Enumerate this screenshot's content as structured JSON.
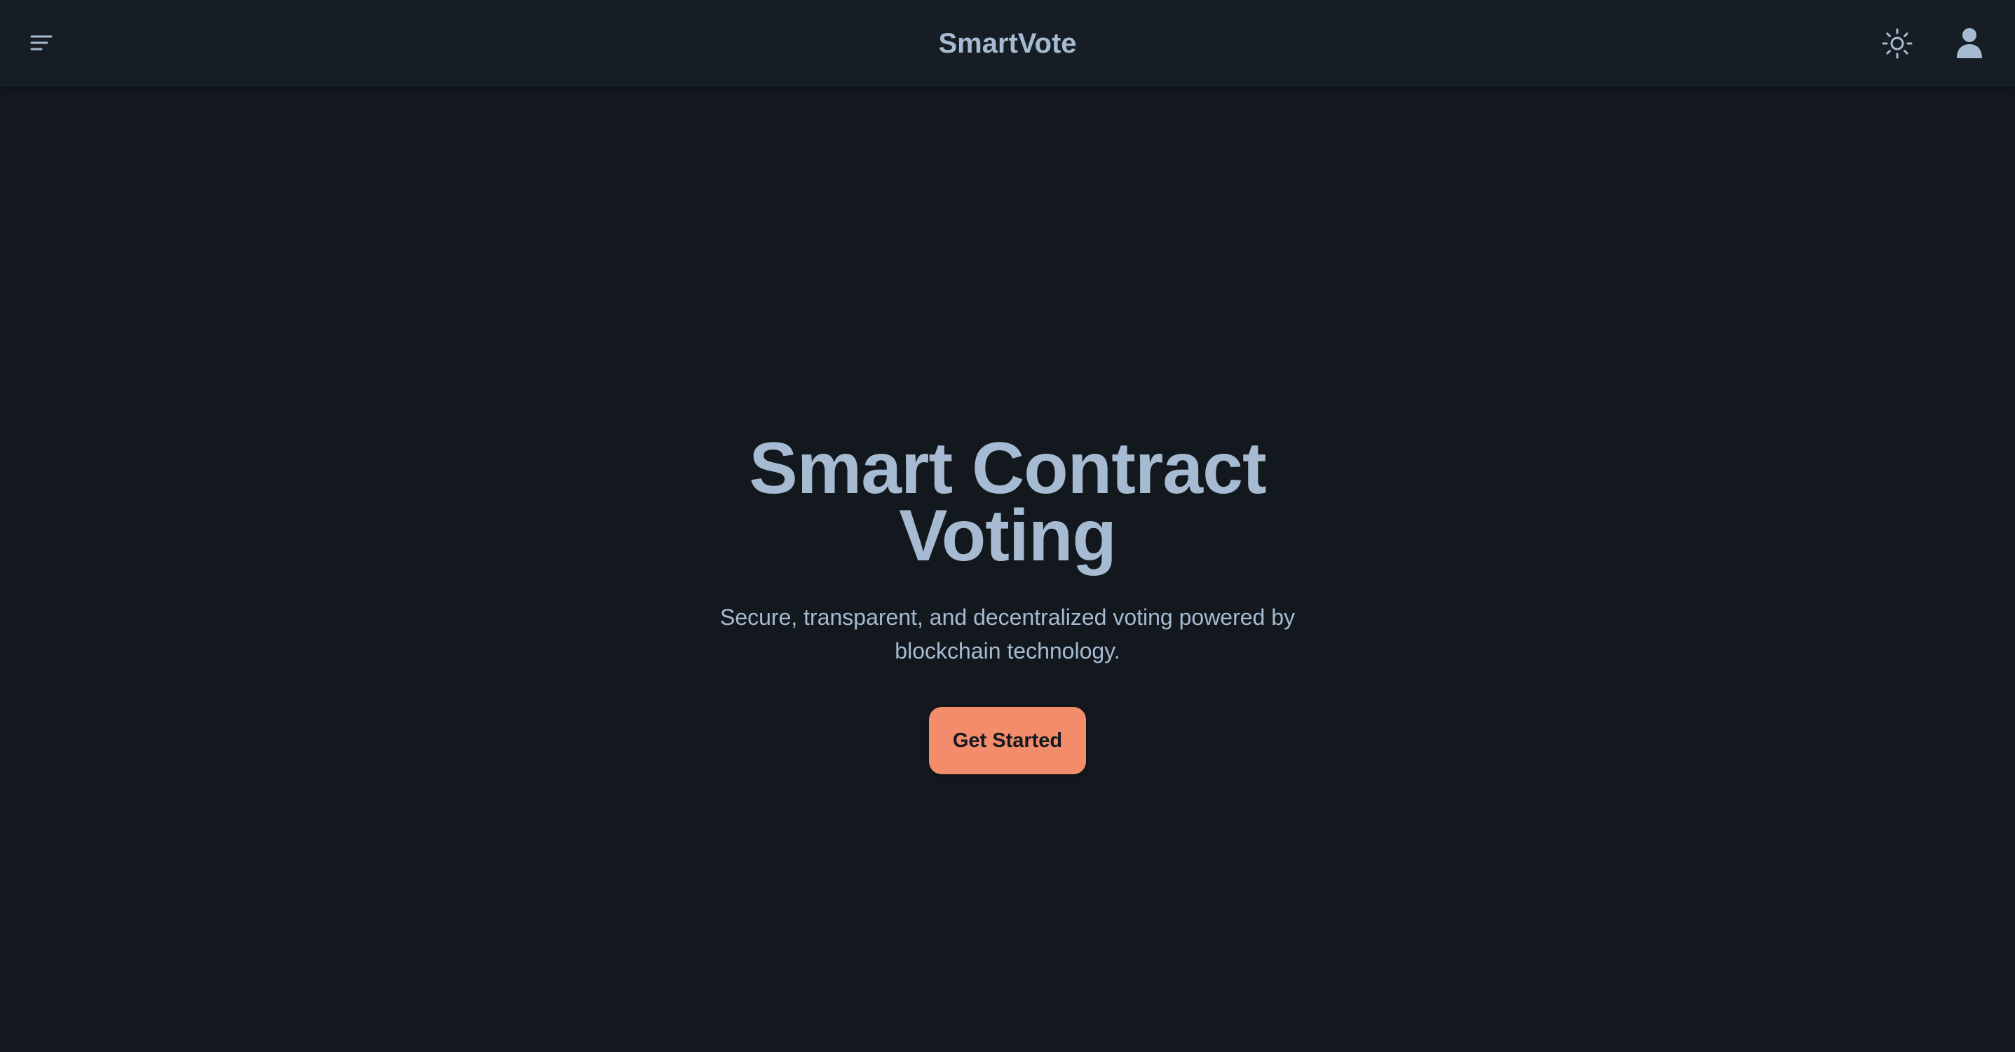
{
  "app": {
    "brand": "SmartVote"
  },
  "header": {
    "menu_icon": "menu-icon",
    "theme_icon": "sun-icon",
    "user_icon": "user-icon"
  },
  "hero": {
    "title": "Smart Contract Voting",
    "subtitle": "Secure, transparent, and decentralized voting powered by blockchain technology.",
    "cta_label": "Get Started"
  },
  "colors": {
    "background": "#12181e",
    "navbar": "#161d24",
    "text": "#a6bbd1",
    "accent": "#f28c6a"
  }
}
